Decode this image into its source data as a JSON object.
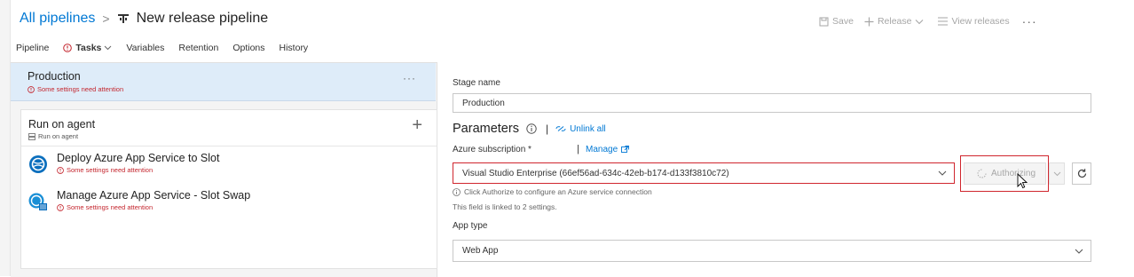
{
  "header": {
    "breadcrumb_root": "All pipelines",
    "separator": ">",
    "pipeline_title": "New release pipeline"
  },
  "actions": {
    "save": "Save",
    "release": "Release",
    "view_releases": "View releases",
    "more": "···"
  },
  "tabs": [
    {
      "label": "Pipeline"
    },
    {
      "label": "Tasks"
    },
    {
      "label": "Variables"
    },
    {
      "label": "Retention"
    },
    {
      "label": "Options"
    },
    {
      "label": "History"
    }
  ],
  "stage": {
    "name": "Production",
    "warning": "Some settings need attention",
    "more": "···"
  },
  "agent": {
    "name": "Run on agent",
    "sub": "Run on agent",
    "add": "+"
  },
  "tasks": [
    {
      "name": "Deploy Azure App Service to Slot",
      "warning": "Some settings need attention"
    },
    {
      "name": "Manage Azure App Service - Slot Swap",
      "warning": "Some settings need attention"
    }
  ],
  "form": {
    "stage_name_label": "Stage name",
    "stage_name_value": "Production",
    "parameters_title": "Parameters",
    "parameters_separator": "|",
    "unlink_all": "Unlink all",
    "subscription_label": "Azure subscription *",
    "manage_separator": "|",
    "manage": "Manage",
    "subscription_value": "Visual Studio Enterprise (66ef56ad-634c-42eb-b174-d133f3810c72)",
    "authorize_label": "Authorizing",
    "authorize_hint": "Click Authorize to configure an Azure service connection",
    "linked_note": "This field is linked to 2 settings.",
    "app_type_label": "App type",
    "app_type_value": "Web App"
  },
  "colors": {
    "accent": "#0078d4",
    "error": "#c4262e",
    "selected_stage": "#deecf9"
  }
}
